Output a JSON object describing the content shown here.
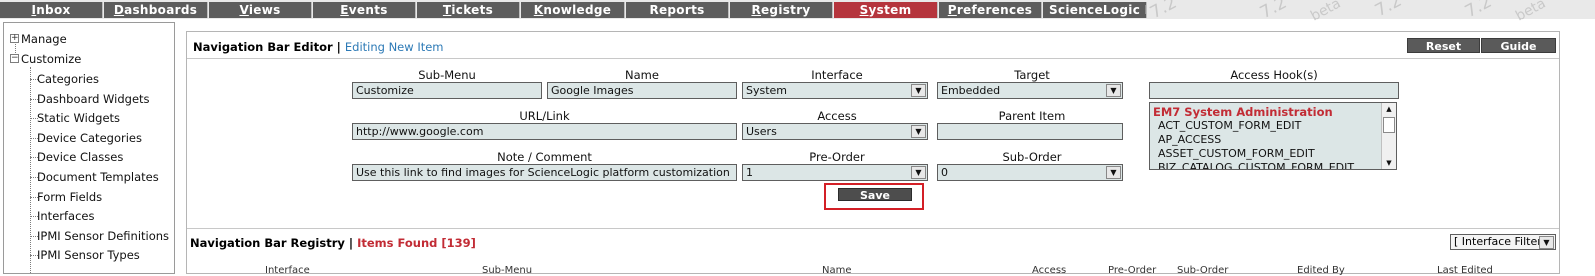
{
  "topnav": {
    "tabs": [
      {
        "first": "I",
        "rest": "nbox",
        "active": false
      },
      {
        "first": "D",
        "rest": "ashboards",
        "active": false
      },
      {
        "first": "V",
        "rest": "iews",
        "active": false
      },
      {
        "first": "E",
        "rest": "vents",
        "active": false
      },
      {
        "first": "T",
        "rest": "ickets",
        "active": false
      },
      {
        "first": "K",
        "rest": "nowledge",
        "active": false
      },
      {
        "first": "",
        "rest": "Reports",
        "active": false
      },
      {
        "first": "R",
        "rest": "egistry",
        "active": false
      },
      {
        "first": "S",
        "rest": "ystem",
        "active": true
      },
      {
        "first": "P",
        "rest": "references",
        "active": false
      }
    ],
    "last_tab": "ScienceLogic Hom",
    "watermark": "7.2",
    "watermark_beta": "beta"
  },
  "sidebar": {
    "items": [
      {
        "label": "Manage",
        "level": 0
      },
      {
        "label": "Customize",
        "level": 0
      },
      {
        "label": "Categories",
        "level": 1
      },
      {
        "label": "Dashboard Widgets",
        "level": 1
      },
      {
        "label": "Static Widgets",
        "level": 1
      },
      {
        "label": "Device Categories",
        "level": 1
      },
      {
        "label": "Device Classes",
        "level": 1
      },
      {
        "label": "Document Templates",
        "level": 1
      },
      {
        "label": "Form Fields",
        "level": 1
      },
      {
        "label": "Interfaces",
        "level": 1
      },
      {
        "label": "IPMI Sensor Definitions",
        "level": 1
      },
      {
        "label": "IPMI Sensor Types",
        "level": 1
      }
    ],
    "toggle_plus": "+",
    "toggle_minus": "−"
  },
  "editor": {
    "title": "Navigation Bar Editor |",
    "subtitle": "Editing New Item",
    "reset_label": "Reset",
    "guide_label": "Guide",
    "labels": {
      "submenu": "Sub-Menu",
      "name": "Name",
      "interface": "Interface",
      "target": "Target",
      "access_hooks": "Access Hook(s)",
      "url": "URL/Link",
      "access": "Access",
      "parent": "Parent Item",
      "note": "Note / Comment",
      "preorder": "Pre-Order",
      "suborder": "Sub-Order"
    },
    "values": {
      "submenu": "Customize",
      "name": "Google Images",
      "interface": "System",
      "target": "Embedded",
      "access_hooks_search": "",
      "url": "http://www.google.com",
      "access": "Users",
      "parent": "",
      "note": "Use this link to find images for ScienceLogic platform customization",
      "preorder": "1",
      "suborder": "0"
    },
    "access_hooks": {
      "group": "EM7 System Administration",
      "options": [
        "ACT_CUSTOM_FORM_EDIT",
        "AP_ACCESS",
        "ASSET_CUSTOM_FORM_EDIT",
        "BIZ_CATALOG_CUSTOM_FORM_EDIT"
      ]
    },
    "save_label": "Save",
    "select_arrow": "▼",
    "scroll_up": "▲",
    "scroll_down": "▼"
  },
  "registry": {
    "title": "Navigation Bar Registry |",
    "count_label": "Items Found [139]",
    "filter_label": "[ Interface Filter ]",
    "columns": [
      "Interface",
      "Sub-Menu",
      "Name",
      "Access",
      "Pre-Order",
      "Sub-Order",
      "Edited By",
      "Last Edited"
    ]
  }
}
